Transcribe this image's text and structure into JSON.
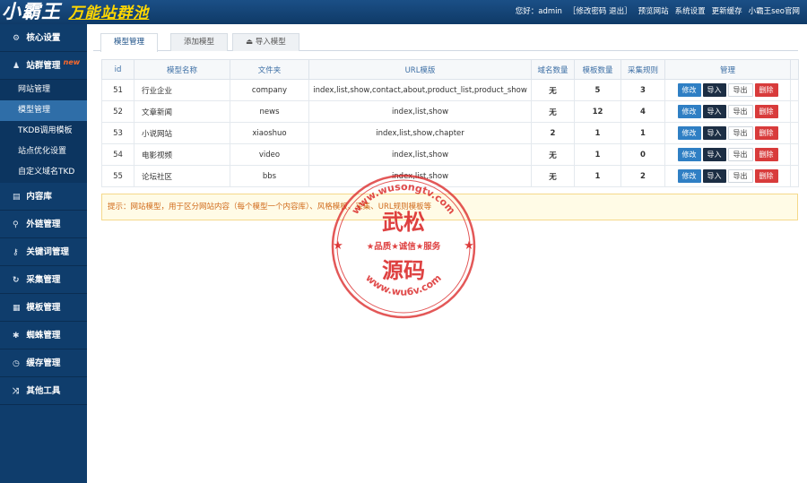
{
  "brand": {
    "name": "小霸王",
    "subtitle": "万能站群池"
  },
  "topnav": {
    "greeting": "您好：admin",
    "account_links": "［修改密码 退出］",
    "preview_site": "预览网站",
    "system_settings": "系统设置",
    "refresh_cache": "更新缓存",
    "official_site": "小霸王seo官网"
  },
  "sidebar": {
    "groups": [
      {
        "label": "核心设置",
        "icon": "gear-icon"
      },
      {
        "label": "站群管理",
        "icon": "user-icon",
        "badge": "new"
      },
      {
        "label": "内容库",
        "icon": "document-icon"
      },
      {
        "label": "外链管理",
        "icon": "link-icon"
      },
      {
        "label": "关键词管理",
        "icon": "key-icon"
      },
      {
        "label": "采集管理",
        "icon": "sync-icon"
      },
      {
        "label": "模板管理",
        "icon": "grid-icon"
      },
      {
        "label": "蜘蛛管理",
        "icon": "spider-icon"
      },
      {
        "label": "缓存管理",
        "icon": "clock-icon"
      },
      {
        "label": "其他工具",
        "icon": "shuffle-icon"
      }
    ],
    "site_submenu": [
      "网站管理",
      "模型管理",
      "TKDB调用模板",
      "站点优化设置",
      "自定义域名TKD"
    ]
  },
  "tabs": [
    "模型管理",
    "添加模型",
    "导入模型"
  ],
  "table": {
    "headers": [
      "id",
      "模型名称",
      "文件夹",
      "URL模版",
      "域名数量",
      "模板数量",
      "采集规则",
      "管理"
    ],
    "rows": [
      {
        "id": "51",
        "name": "行业企业",
        "folder": "company",
        "url": "index,list,show,contact,about,product_list,product_show",
        "domains": "无",
        "templates": "5",
        "rules": "3"
      },
      {
        "id": "52",
        "name": "文章新闻",
        "folder": "news",
        "url": "index,list,show",
        "domains": "无",
        "templates": "12",
        "rules": "4"
      },
      {
        "id": "53",
        "name": "小说网站",
        "folder": "xiaoshuo",
        "url": "index,list,show,chapter",
        "domains": "2",
        "templates": "1",
        "rules": "1"
      },
      {
        "id": "54",
        "name": "电影视频",
        "folder": "video",
        "url": "index,list,show",
        "domains": "无",
        "templates": "1",
        "rules": "0"
      },
      {
        "id": "55",
        "name": "论坛社区",
        "folder": "bbs",
        "url": "index,list,show",
        "domains": "无",
        "templates": "1",
        "rules": "2"
      }
    ],
    "actions": {
      "edit": "修改",
      "import": "导入",
      "export": "导出",
      "delete": "删除"
    }
  },
  "tip": "提示：网站模型，用于区分网站内容（每个模型一个内容库）、风格模板、采集、URL规则模板等",
  "watermark": {
    "url_top": "www.wusongtv.com",
    "line1": "武松",
    "line2": "★品质★诚信★服务",
    "line3": "源码",
    "url_bottom": "www.wu6v.com"
  },
  "colors": {
    "header_bg": "#0f3a67",
    "sidebar_bg": "#0f3d6c",
    "active_item": "#2f6ea8",
    "edit": "#2f7fc4",
    "import": "#1c2e44",
    "delete": "#d83b3b",
    "stamp": "#d92020"
  }
}
